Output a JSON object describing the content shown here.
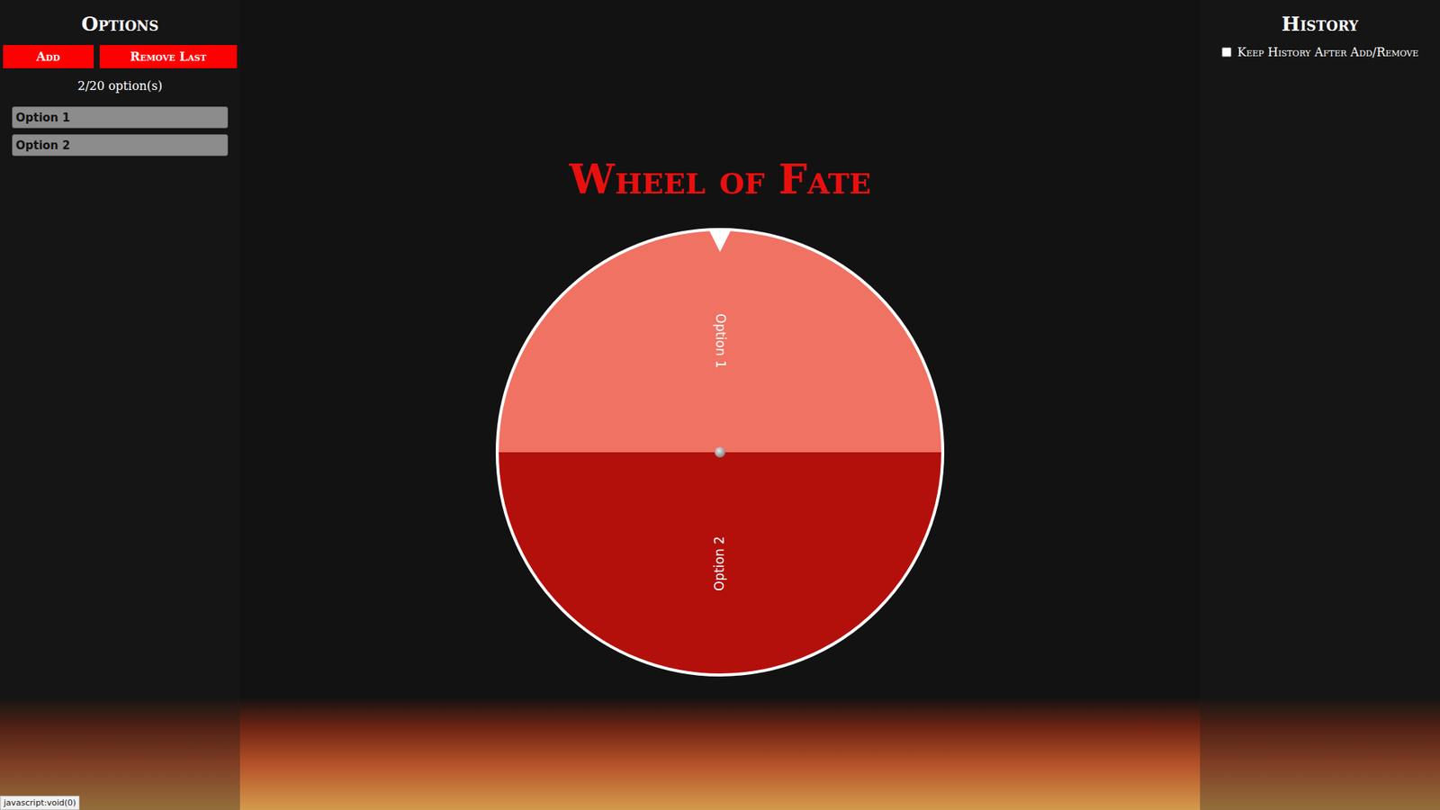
{
  "options_panel": {
    "title": "Options",
    "buttons": [
      "Add",
      "Remove Last"
    ],
    "count": "2/20 option(s)",
    "items": [
      {
        "label": "Option 1"
      },
      {
        "label": "Option 2"
      }
    ]
  },
  "wheel": {
    "title": "Wheel of Fate",
    "slices": [
      {
        "label": "Option 1",
        "color": "#f07262"
      },
      {
        "label": "Option 2",
        "color": "#b3100c"
      }
    ]
  },
  "history_panel": {
    "title": "History",
    "keep_history": {
      "label": "Keep History After Add/Remove",
      "checked": false
    }
  },
  "status_bar": {
    "text": "javascript:void(0)"
  }
}
